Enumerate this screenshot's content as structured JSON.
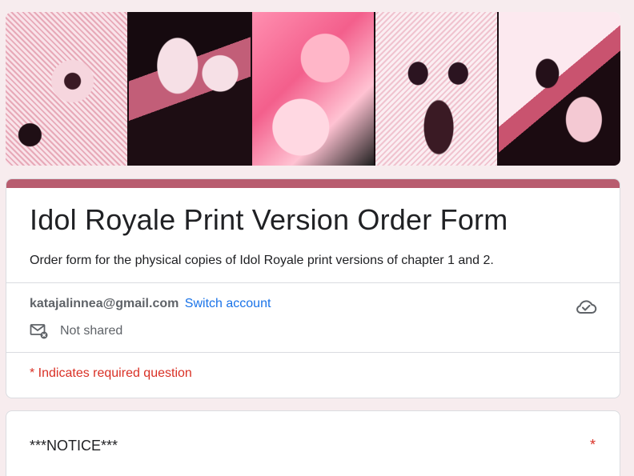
{
  "banner": {
    "panels": [
      "manga-panel-1",
      "manga-panel-2",
      "manga-panel-3",
      "manga-panel-4",
      "manga-panel-5"
    ],
    "accent_color": "#b85c6f"
  },
  "form": {
    "title": "Idol Royale Print Version Order Form",
    "description": "Order form for the physical copies of Idol Royale print versions of chapter 1 and 2."
  },
  "account": {
    "email": "katajalinnea@gmail.com",
    "switch_label": "Switch account",
    "shared_status": "Not shared",
    "cloud_icon": "cloud-saved-icon",
    "mail_icon": "mail-not-shared-icon"
  },
  "required_note": "* Indicates required question",
  "question": {
    "title": "***NOTICE***",
    "required_marker": "*"
  },
  "colors": {
    "background": "#f7ecee",
    "link": "#1a73e8",
    "required": "#d93025"
  }
}
